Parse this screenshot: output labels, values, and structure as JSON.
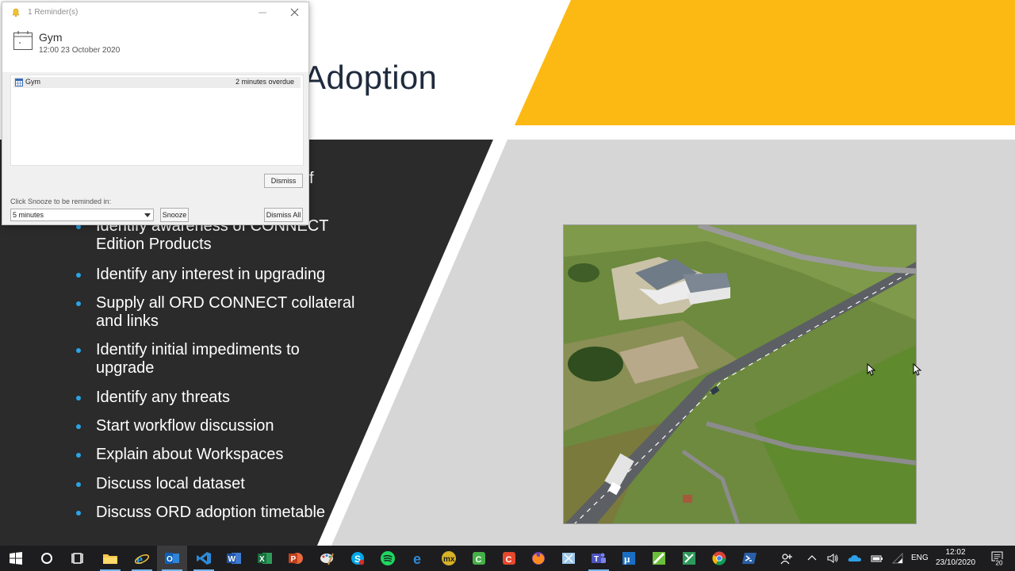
{
  "slide": {
    "title": "Adoption",
    "cut_text": "f",
    "bullets": [
      "Identify awareness of CONNECT Edition Products",
      "Identify any interest in upgrading",
      "Supply all ORD CONNECT collateral and links",
      "Identify initial impediments to upgrade",
      "Identify any threats",
      "Start workflow discussion",
      "Explain about Workspaces",
      "Discuss local dataset",
      "Discuss ORD adoption timetable"
    ]
  },
  "reminder": {
    "window_title": "1 Reminder(s)",
    "subject": "Gym",
    "when": "12:00 23 October 2020",
    "items": [
      {
        "name": "Gym",
        "due": "2 minutes overdue"
      }
    ],
    "dismiss_label": "Dismiss",
    "snooze_prompt": "Click Snooze to be reminded in:",
    "snooze_value": "5 minutes",
    "snooze_label": "Snooze",
    "dismiss_all_label": "Dismiss All"
  },
  "taskbar": {
    "language": "ENG",
    "time": "12:02",
    "date": "23/10/2020",
    "notification_count": "20",
    "apps": [
      "start-icon",
      "cortana-icon",
      "task-view-icon",
      "file-explorer-icon",
      "internet-explorer-icon",
      "outlook-icon",
      "visual-studio-icon",
      "word-icon",
      "excel-icon",
      "powerpoint-icon",
      "paint-icon",
      "skype-icon",
      "spotify-icon",
      "edge-icon",
      "mx-icon",
      "camtasia-icon",
      "snagit-icon",
      "firefox-icon",
      "snipping-tool-icon",
      "teams-icon",
      "microstation-icon",
      "openroads-icon",
      "excel-alt-icon",
      "chrome-icon",
      "powershell-icon"
    ]
  },
  "colors": {
    "accent_yellow": "#fdb913",
    "dark_panel": "#2b2b2b",
    "bullet_blue": "#2aa4e8",
    "taskbar": "#1d1d1f"
  }
}
